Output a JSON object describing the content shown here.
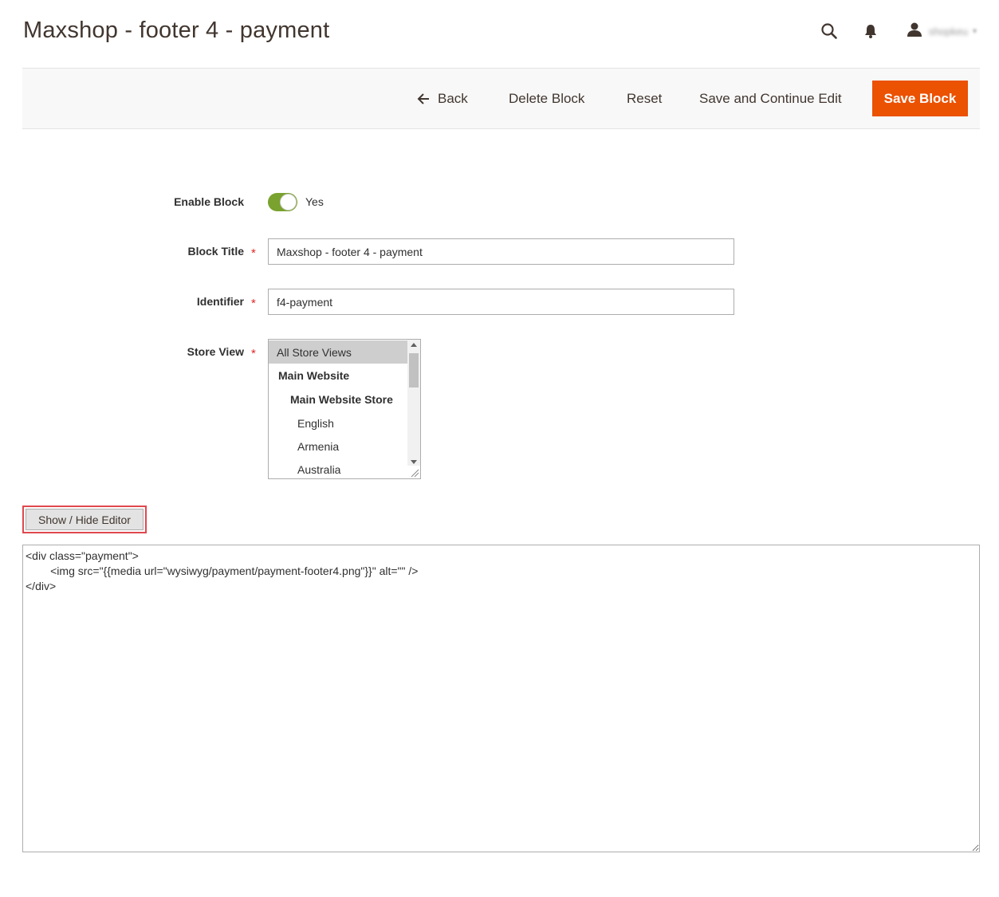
{
  "page": {
    "title": "Maxshop - footer 4 - payment"
  },
  "header": {
    "search_icon": "search-icon",
    "notifications_icon": "bell-icon",
    "user_icon": "user-icon",
    "user_name": "shopkeu",
    "user_caret": "▾"
  },
  "actions": {
    "back_label": "Back",
    "delete_label": "Delete Block",
    "reset_label": "Reset",
    "save_continue_label": "Save and Continue Edit",
    "save_label": "Save Block",
    "accent_color": "#eb5202"
  },
  "form": {
    "enable_block": {
      "label": "Enable Block",
      "value_text": "Yes",
      "enabled": true,
      "toggle_color": "#79a22e"
    },
    "block_title": {
      "label": "Block Title",
      "required_mark": "*",
      "value": "Maxshop - footer 4 - payment"
    },
    "identifier": {
      "label": "Identifier",
      "required_mark": "*",
      "value": "f4-payment"
    },
    "store_view": {
      "label": "Store View",
      "required_mark": "*",
      "options": [
        {
          "label": "All Store Views",
          "selected": true,
          "bold": false
        },
        {
          "label": "Main Website",
          "selected": false,
          "bold": true
        },
        {
          "label": "Main Website Store",
          "selected": false,
          "bold": true
        },
        {
          "label": "English",
          "selected": false,
          "bold": false
        },
        {
          "label": "Armenia",
          "selected": false,
          "bold": false
        },
        {
          "label": "Australia",
          "selected": false,
          "bold": false
        }
      ]
    }
  },
  "editor": {
    "toggle_label": "Show / Hide Editor",
    "content": "<div class=\"payment\">\n        <img src=\"{{media url=\"wysiwyg/payment/payment-footer4.png\"}}\" alt=\"\" />\n</div>"
  }
}
